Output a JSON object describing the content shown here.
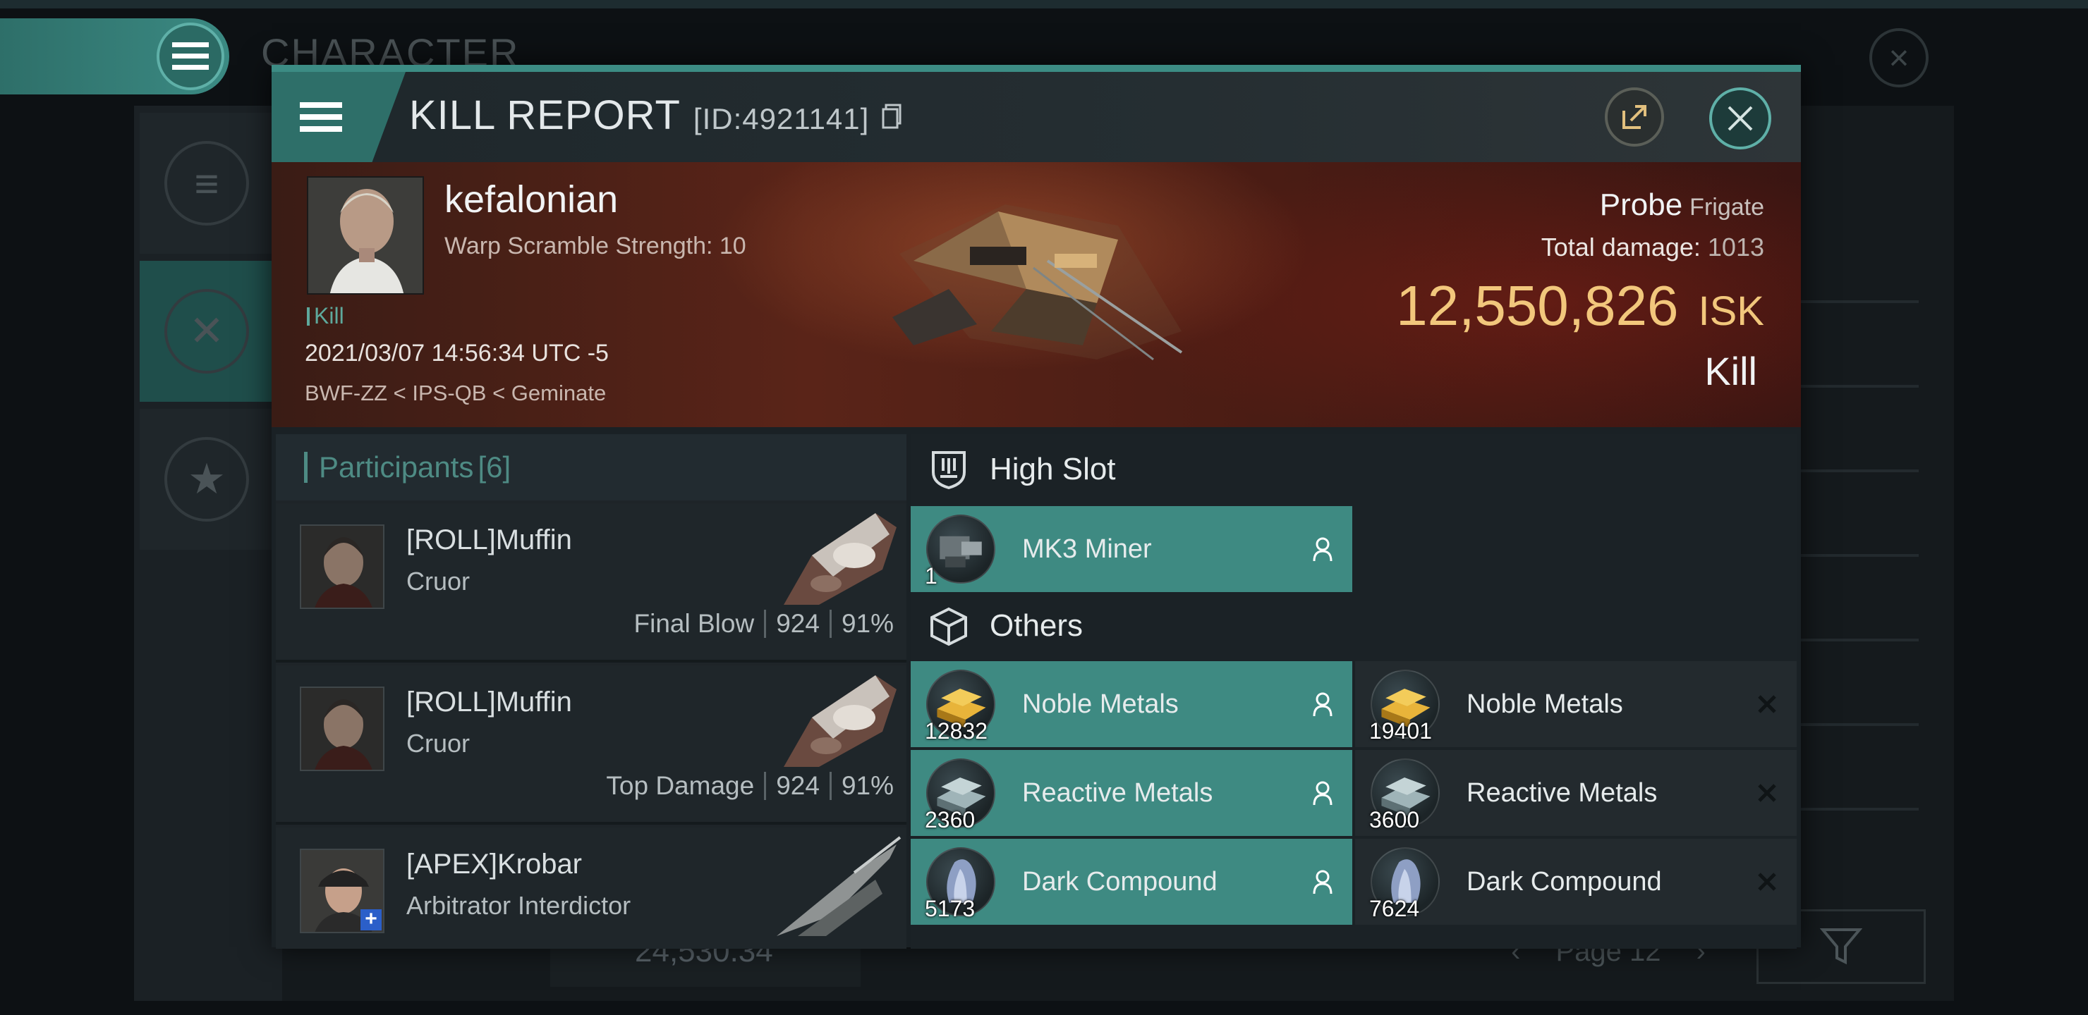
{
  "background": {
    "title": "CHARACTER",
    "search_value": "24,530.34",
    "page_label": "Page 12"
  },
  "modal": {
    "title": "KILL REPORT",
    "report_id": "[ID:4921141]",
    "victim": {
      "name": "kefalonian",
      "scramble": "Warp Scramble Strength: 10",
      "tag": "Kill",
      "datetime": "2021/03/07 14:56:34 UTC -5",
      "location": "BWF-ZZ < IPS-QB < Geminate"
    },
    "ship": {
      "name": "Probe",
      "class": "Frigate",
      "damage_label": "Total damage:",
      "damage_value": "1013",
      "isk_value": "12,550,826",
      "isk_unit": "ISK",
      "result": "Kill"
    },
    "participants": {
      "label": "Participants",
      "count": "[6]",
      "rows": [
        {
          "name": "[ROLL]Muffin",
          "ship": "Cruor",
          "role": "Final Blow",
          "damage": "924",
          "percent": "91%"
        },
        {
          "name": "[ROLL]Muffin",
          "ship": "Cruor",
          "role": "Top Damage",
          "damage": "924",
          "percent": "91%"
        },
        {
          "name": "[APEX]Krobar",
          "ship": "Arbitrator Interdictor"
        }
      ]
    },
    "fitting": {
      "high_slot": {
        "label": "High Slot",
        "items": [
          {
            "name": "MK3 Miner",
            "qty": "1",
            "status": "dropped"
          }
        ]
      },
      "others": {
        "label": "Others",
        "items": [
          {
            "name": "Noble Metals",
            "qty": "12832",
            "status": "dropped"
          },
          {
            "name": "Noble Metals",
            "qty": "19401",
            "status": "destroyed"
          },
          {
            "name": "Reactive Metals",
            "qty": "2360",
            "status": "dropped"
          },
          {
            "name": "Reactive Metals",
            "qty": "3600",
            "status": "destroyed"
          },
          {
            "name": "Dark Compound",
            "qty": "5173",
            "status": "dropped"
          },
          {
            "name": "Dark Compound",
            "qty": "7624",
            "status": "destroyed"
          }
        ]
      }
    }
  },
  "colors": {
    "accent": "#3e8a82",
    "isk": "#f2c77c",
    "banner": "#5a2418"
  },
  "icons": {
    "menu": "hamburger-icon",
    "share": "share-icon",
    "close": "close-icon",
    "high_slot": "high-slot-icon",
    "others": "cargo-box-icon",
    "dropped": "person-icon",
    "destroyed": "x-icon"
  }
}
